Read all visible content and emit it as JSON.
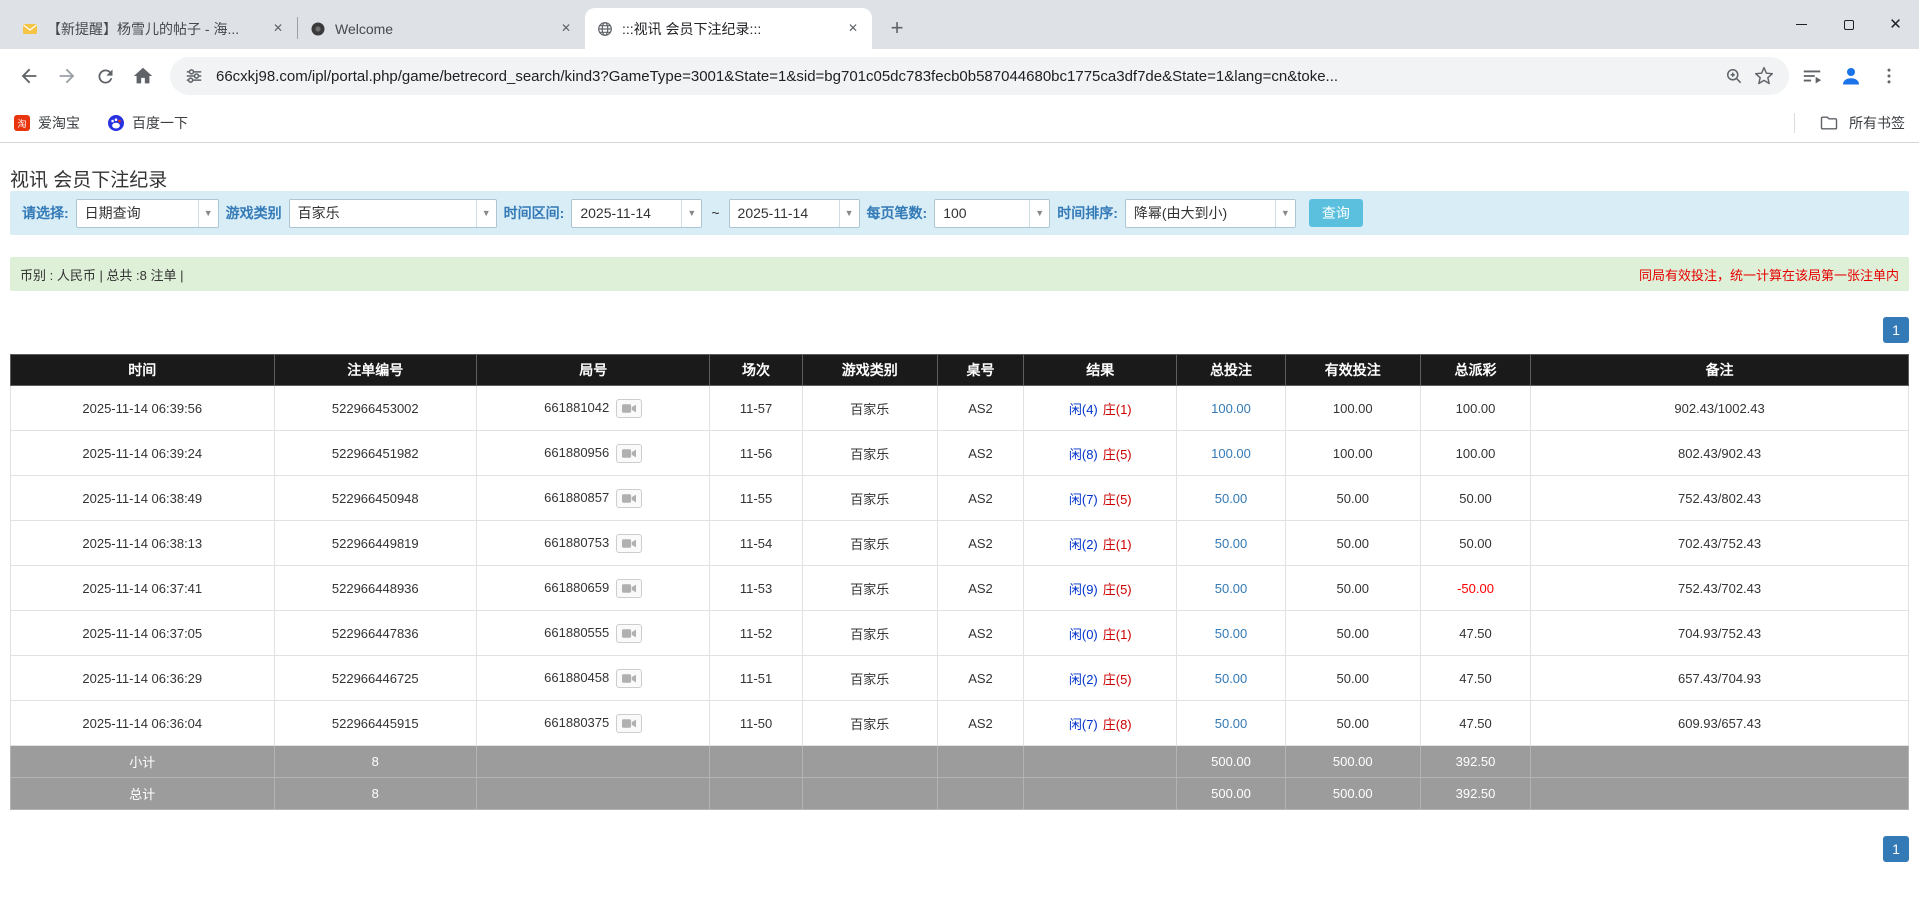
{
  "colors": {
    "accent": "#337ab7",
    "search_btn": "#5bc0de",
    "filter_bg": "#d9edf7",
    "info_bg": "#dff0d8",
    "info_right_text": "#e60000",
    "header_bg": "#1a1a1a",
    "summary_bg": "#9c9c9c",
    "player_blue": "#0033cc",
    "banker_red": "#cc0000",
    "negative_red": "#ff0000"
  },
  "browser": {
    "tabs": [
      {
        "title": "【新提醒】杨雪儿的帖子 - 海...",
        "favicon": "mail-icon",
        "active": false
      },
      {
        "title": "Welcome",
        "favicon": "dark-logo-icon",
        "active": false
      },
      {
        "title": ":::视讯 会员下注纪录:::",
        "favicon": "globe-icon",
        "active": true
      }
    ],
    "close_glyph": "✕",
    "new_tab_glyph": "+",
    "url": "66cxkj98.com/ipl/portal.php/game/betrecord_search/kind3?GameType=3001&State=1&sid=bg701c05dc783fecb0b587044680bc1775ca3df7de&State=1&lang=cn&toke...",
    "bookmarks": {
      "items": [
        {
          "label": "爱淘宝",
          "icon": "taobao-icon"
        },
        {
          "label": "百度一下",
          "icon": "baidu-icon"
        }
      ],
      "all_label": "所有书签"
    }
  },
  "page": {
    "title": "视讯 会员下注纪录",
    "filter": {
      "select_label": "请选择:",
      "select_value": "日期查询",
      "game_label": "游戏类别",
      "game_value": "百家乐",
      "range_label": "时间区间:",
      "date_from": "2025-11-14",
      "tilde": "~",
      "date_to": "2025-11-14",
      "pagesize_label": "每页笔数:",
      "pagesize_value": "100",
      "sort_label": "时间排序:",
      "sort_value": "降幂(由大到小)",
      "search_label": "查询",
      "arrow_glyph": "▼"
    },
    "infobar": {
      "left": "币别 : 人民币 | 总共 :8 注单 |",
      "right": "同局有效投注，统一计算在该局第一张注单内"
    },
    "pager": {
      "page": "1"
    },
    "table": {
      "headers": [
        "时间",
        "注单编号",
        "局号",
        "场次",
        "游戏类别",
        "桌号",
        "结果",
        "总投注",
        "有效投注",
        "总派彩",
        "备注"
      ],
      "rows": [
        {
          "time": "2025-11-14 06:39:56",
          "bet_id": "522966453002",
          "round": "661881042",
          "session": "11-57",
          "game": "百家乐",
          "table": "AS2",
          "result_player": "闲(4)",
          "result_banker": "庄(1)",
          "total_bet": "100.00",
          "valid_bet": "100.00",
          "payout": "100.00",
          "note": "902.43/1002.43"
        },
        {
          "time": "2025-11-14 06:39:24",
          "bet_id": "522966451982",
          "round": "661880956",
          "session": "11-56",
          "game": "百家乐",
          "table": "AS2",
          "result_player": "闲(8)",
          "result_banker": "庄(5)",
          "total_bet": "100.00",
          "valid_bet": "100.00",
          "payout": "100.00",
          "note": "802.43/902.43"
        },
        {
          "time": "2025-11-14 06:38:49",
          "bet_id": "522966450948",
          "round": "661880857",
          "session": "11-55",
          "game": "百家乐",
          "table": "AS2",
          "result_player": "闲(7)",
          "result_banker": "庄(5)",
          "total_bet": "50.00",
          "valid_bet": "50.00",
          "payout": "50.00",
          "note": "752.43/802.43"
        },
        {
          "time": "2025-11-14 06:38:13",
          "bet_id": "522966449819",
          "round": "661880753",
          "session": "11-54",
          "game": "百家乐",
          "table": "AS2",
          "result_player": "闲(2)",
          "result_banker": "庄(1)",
          "total_bet": "50.00",
          "valid_bet": "50.00",
          "payout": "50.00",
          "note": "702.43/752.43"
        },
        {
          "time": "2025-11-14 06:37:41",
          "bet_id": "522966448936",
          "round": "661880659",
          "session": "11-53",
          "game": "百家乐",
          "table": "AS2",
          "result_player": "闲(9)",
          "result_banker": "庄(5)",
          "total_bet": "50.00",
          "valid_bet": "50.00",
          "payout": "-50.00",
          "note": "752.43/702.43"
        },
        {
          "time": "2025-11-14 06:37:05",
          "bet_id": "522966447836",
          "round": "661880555",
          "session": "11-52",
          "game": "百家乐",
          "table": "AS2",
          "result_player": "闲(0)",
          "result_banker": "庄(1)",
          "total_bet": "50.00",
          "valid_bet": "50.00",
          "payout": "47.50",
          "note": "704.93/752.43"
        },
        {
          "time": "2025-11-14 06:36:29",
          "bet_id": "522966446725",
          "round": "661880458",
          "session": "11-51",
          "game": "百家乐",
          "table": "AS2",
          "result_player": "闲(2)",
          "result_banker": "庄(5)",
          "total_bet": "50.00",
          "valid_bet": "50.00",
          "payout": "47.50",
          "note": "657.43/704.93"
        },
        {
          "time": "2025-11-14 06:36:04",
          "bet_id": "522966445915",
          "round": "661880375",
          "session": "11-50",
          "game": "百家乐",
          "table": "AS2",
          "result_player": "闲(7)",
          "result_banker": "庄(8)",
          "total_bet": "50.00",
          "valid_bet": "50.00",
          "payout": "47.50",
          "note": "609.93/657.43"
        }
      ],
      "subtotal": {
        "label": "小计",
        "count": "8",
        "total_bet": "500.00",
        "valid_bet": "500.00",
        "payout": "392.50"
      },
      "total": {
        "label": "总计",
        "count": "8",
        "total_bet": "500.00",
        "valid_bet": "500.00",
        "payout": "392.50"
      }
    }
  }
}
